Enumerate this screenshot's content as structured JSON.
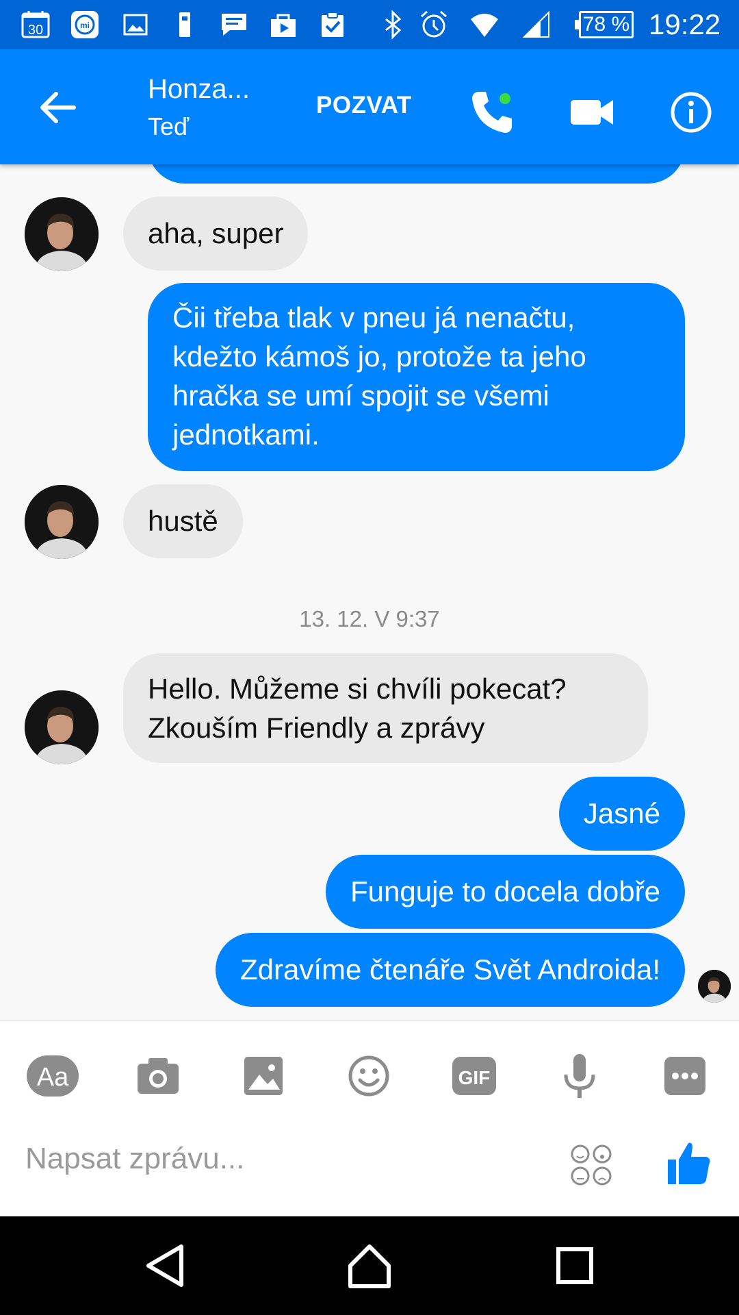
{
  "status_bar": {
    "calendar_day": "30",
    "battery": "78 %",
    "time": "19:22",
    "icons": [
      "calendar-icon",
      "mi-icon",
      "gallery-icon",
      "usb-icon",
      "message-icon",
      "play-store-icon",
      "clipboard-check-icon",
      "bluetooth-icon",
      "alarm-icon",
      "wifi-icon",
      "signal-icon"
    ]
  },
  "header": {
    "contact_name": "Honza...",
    "contact_status": "Teď",
    "invite_label": "POZVAT",
    "active_dot_color": "#3ddc3d"
  },
  "messages": [
    {
      "id": "m1",
      "from": "them",
      "text": "aha, super"
    },
    {
      "id": "m2",
      "from": "me",
      "lines": [
        "Čii třeba tlak v pneu já nenačtu,",
        "kdežto kámoš jo, protože ta jeho",
        "hračka se umí spojit se všemi",
        "jednotkami."
      ]
    },
    {
      "id": "m3",
      "from": "them",
      "text": "hustě"
    },
    {
      "id": "m4",
      "from": "them",
      "lines": [
        "Hello. Můžeme si chvíli pokecat?",
        "Zkouším Friendly a zprávy"
      ]
    },
    {
      "id": "m5",
      "from": "me",
      "text": "Jasné"
    },
    {
      "id": "m6",
      "from": "me",
      "text": "Funguje to docela dobře"
    },
    {
      "id": "m7",
      "from": "me",
      "text": "Zdravíme čtenáře Svět Androida!"
    }
  ],
  "date_separator": "13. 12. V 9:37",
  "composer": {
    "text_tool_label": "Aa",
    "gif_label": "GIF",
    "placeholder": "Napsat zprávu...",
    "tools": [
      "text-format-icon",
      "camera-icon",
      "image-icon",
      "emoji-icon",
      "gif-icon",
      "microphone-icon",
      "more-icon",
      "sticker-icon",
      "thumbs-up-icon"
    ]
  },
  "colors": {
    "status_bar": "#0066d6",
    "app_bar": "#0084ff",
    "outgoing_bubble": "#0084ff",
    "incoming_bubble": "#e9e9e9",
    "tool_icon": "#8c8c8c"
  }
}
